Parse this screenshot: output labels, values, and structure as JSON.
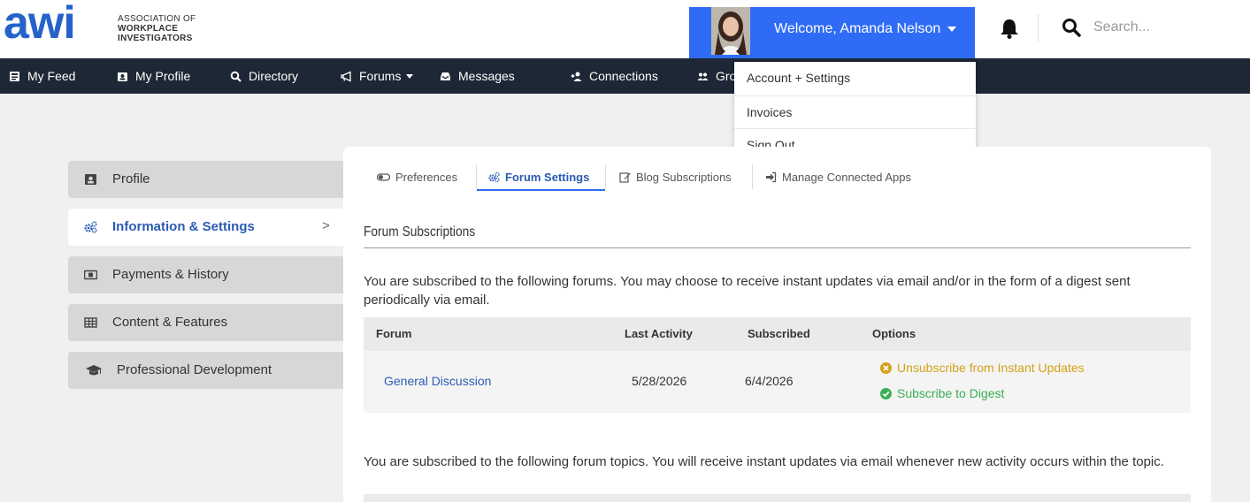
{
  "brand": {
    "logo_word": "awi",
    "line1": "ASSOCIATION OF",
    "line2": "WORKPLACE",
    "line3": "INVESTIGATORS",
    "accent_color": "#2563c9"
  },
  "header": {
    "welcome_text": "Welcome, Amanda Nelson",
    "search_placeholder": "Search...",
    "welcome_bg": "#2f6cf5"
  },
  "nav": {
    "items": [
      {
        "label": "My Feed",
        "icon": "feed-icon"
      },
      {
        "label": "My Profile",
        "icon": "id-card-icon"
      },
      {
        "label": "Directory",
        "icon": "search-icon"
      },
      {
        "label": "Forums",
        "icon": "megaphone-icon"
      },
      {
        "label": "Messages",
        "icon": "inbox-icon"
      },
      {
        "label": "Connections",
        "icon": "user-plus-icon"
      },
      {
        "label": "Gro",
        "icon": "users-icon"
      }
    ],
    "bg": "#1d2735"
  },
  "account_menu": {
    "items": [
      "Account + Settings",
      "Invoices",
      "Sign Out"
    ]
  },
  "sidebar": {
    "items": [
      {
        "label": "Profile",
        "icon": "id-card-icon"
      },
      {
        "label": "Information & Settings",
        "icon": "cogs-icon",
        "chevron": ">"
      },
      {
        "label": "Payments & History",
        "icon": "money-icon"
      },
      {
        "label": "Content & Features",
        "icon": "table-icon"
      },
      {
        "label": "Professional Development",
        "icon": "graduation-cap-icon"
      }
    ],
    "active": "Information & Settings"
  },
  "tabs": {
    "items": [
      {
        "label": "Preferences",
        "icon": "toggle-icon"
      },
      {
        "label": "Forum Settings",
        "icon": "cogs-icon"
      },
      {
        "label": "Blog Subscriptions",
        "icon": "edit-icon"
      },
      {
        "label": "Manage Connected Apps",
        "icon": "sign-in-icon"
      }
    ],
    "active": "Forum Settings"
  },
  "forum_subscriptions": {
    "title": "Forum Subscriptions",
    "intro": "You are subscribed to the following forums. You may choose to receive instant updates via email and/or in the form of a digest sent periodically via email.",
    "columns": [
      "Forum",
      "Last Activity",
      "Subscribed",
      "Options"
    ],
    "rows": [
      {
        "forum": "General Discussion",
        "last_activity": "5/28/2026",
        "subscribed": "6/4/2026",
        "options": [
          "Unsubscribe from Instant Updates",
          "Subscribe to Digest"
        ]
      }
    ],
    "topics_intro": "You are subscribed to the following forum topics. You will receive instant updates via email whenever new activity occurs within the topic."
  }
}
